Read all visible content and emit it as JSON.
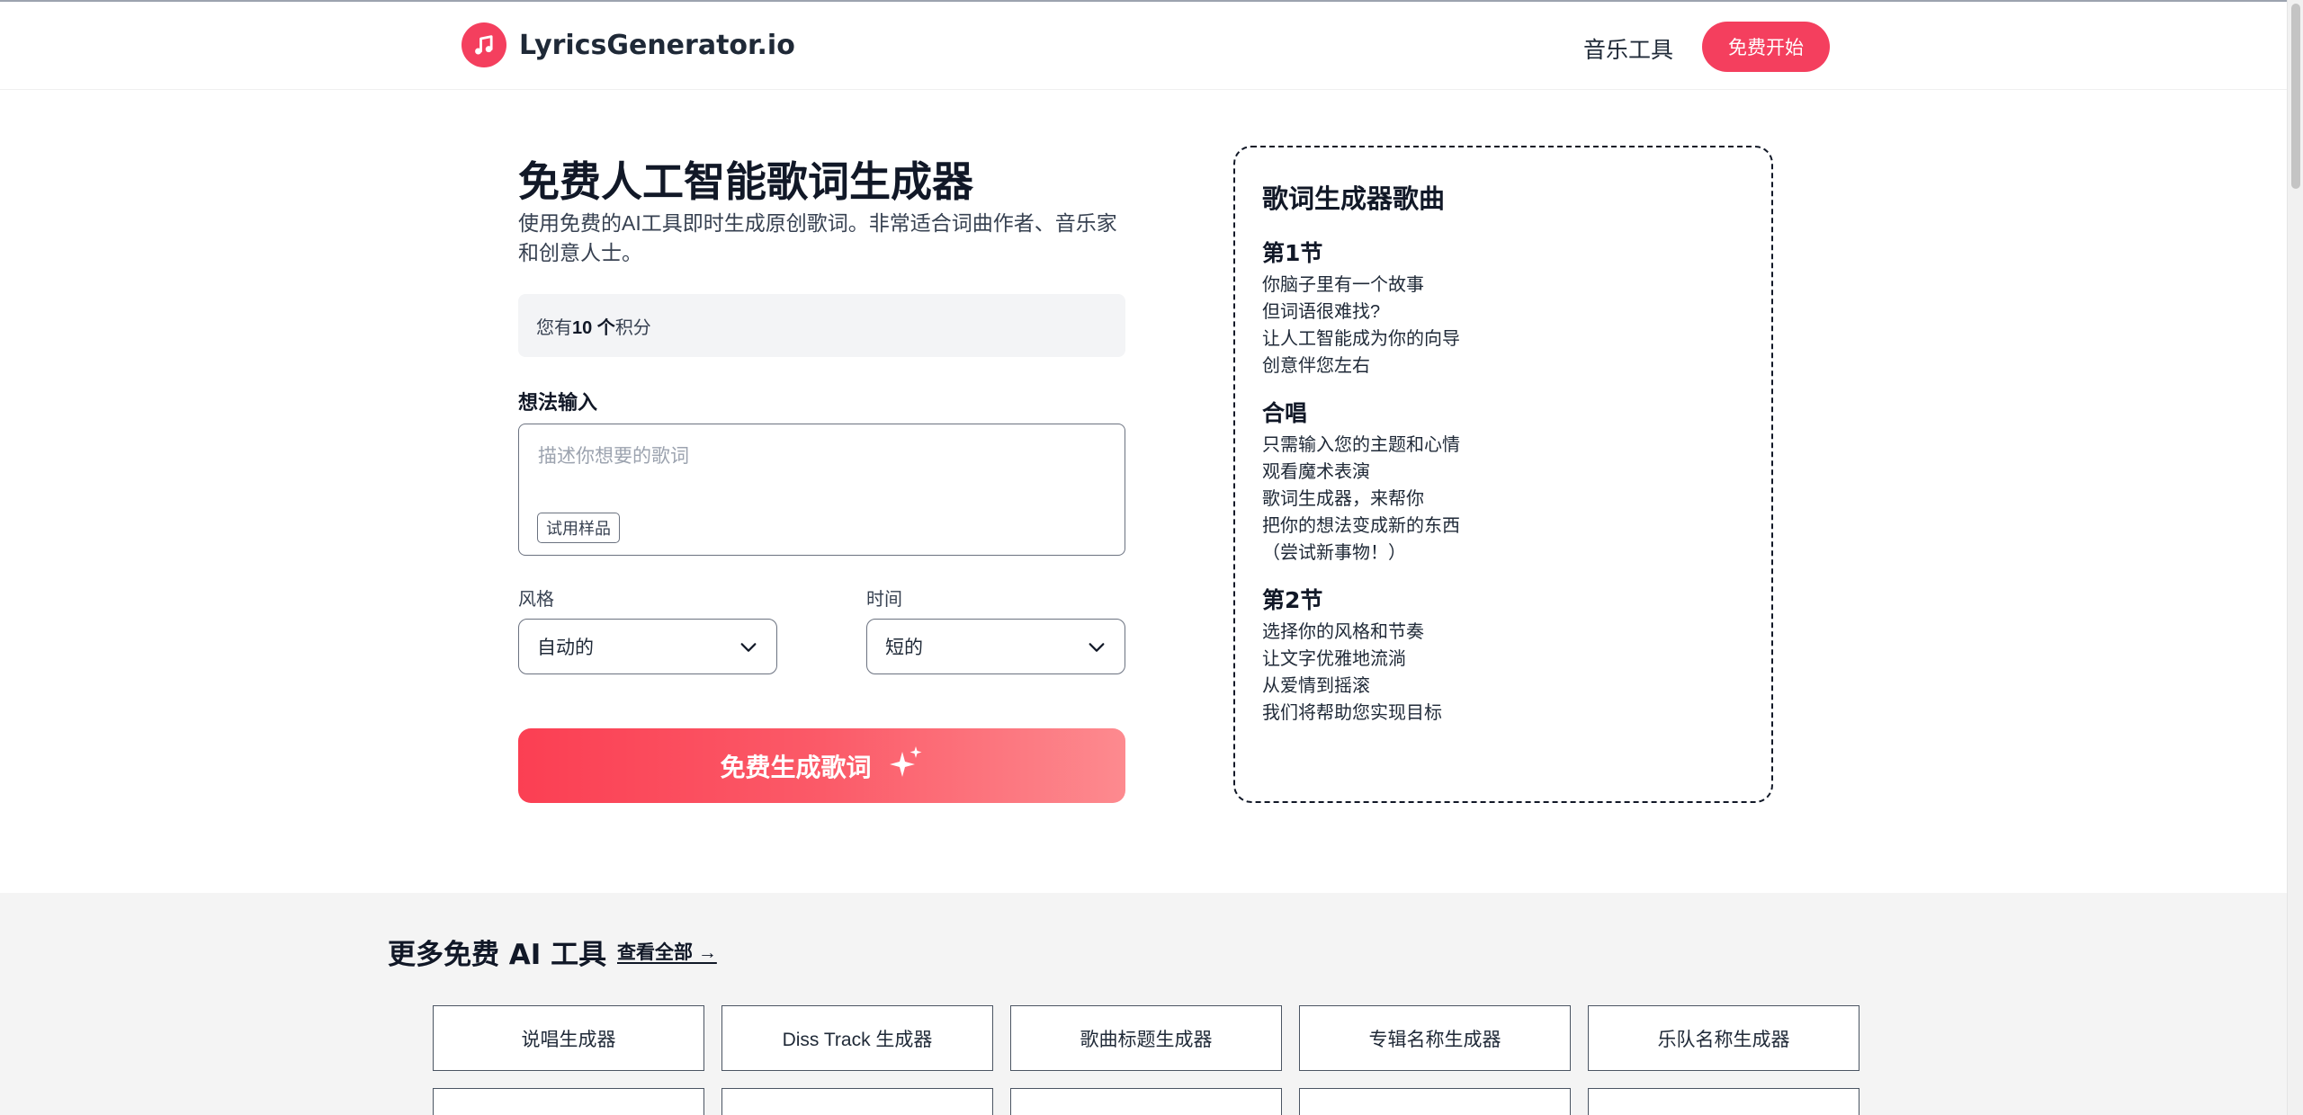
{
  "header": {
    "brand": "LyricsGenerator.io",
    "nav_tools": "音乐工具",
    "cta": "免费开始"
  },
  "form": {
    "title": "免费人工智能歌词生成器",
    "subtitle": "使用免费的AI工具即时生成原创歌词。非常适合词曲作者、音乐家和创意人士。",
    "credits_prefix": "您有",
    "credits_amount": "10 个",
    "credits_suffix": "积分",
    "idea_label": "想法输入",
    "idea_placeholder": "描述你想要的歌词",
    "sample_button": "试用样品",
    "style_label": "风格",
    "style_value": "自动的",
    "time_label": "时间",
    "time_value": "短的",
    "generate_button": "免费生成歌词"
  },
  "sample_song": {
    "title": "歌词生成器歌曲",
    "sections": [
      {
        "title": "第1节",
        "lines": [
          "你脑子里有一个故事",
          "但词语很难找?",
          "让人工智能成为你的向导",
          "创意伴您左右"
        ]
      },
      {
        "title": "合唱",
        "lines": [
          "只需输入您的主题和心情",
          "观看魔术表演",
          "歌词生成器，来帮你",
          "把你的想法变成新的东西",
          "（尝试新事物！）"
        ]
      },
      {
        "title": "第2节",
        "lines": [
          "选择你的风格和节奏",
          "让文字优雅地流淌",
          "从爱情到摇滚",
          "我们将帮助您实现目标"
        ]
      }
    ]
  },
  "more_tools": {
    "title": "更多免费 AI 工具",
    "view_all": "查看全部 →",
    "tools": [
      "说唱生成器",
      "Diss Track 生成器",
      "歌曲标题生成器",
      "专辑名称生成器",
      "乐队名称生成器"
    ]
  },
  "colors": {
    "accent": "#f43f5e",
    "gradient_start": "#fb3f53",
    "gradient_end": "#fd8a8f"
  },
  "icons": {
    "logo": "music-note-icon",
    "dropdown": "chevron-down-icon",
    "generate": "sparkles-icon"
  }
}
